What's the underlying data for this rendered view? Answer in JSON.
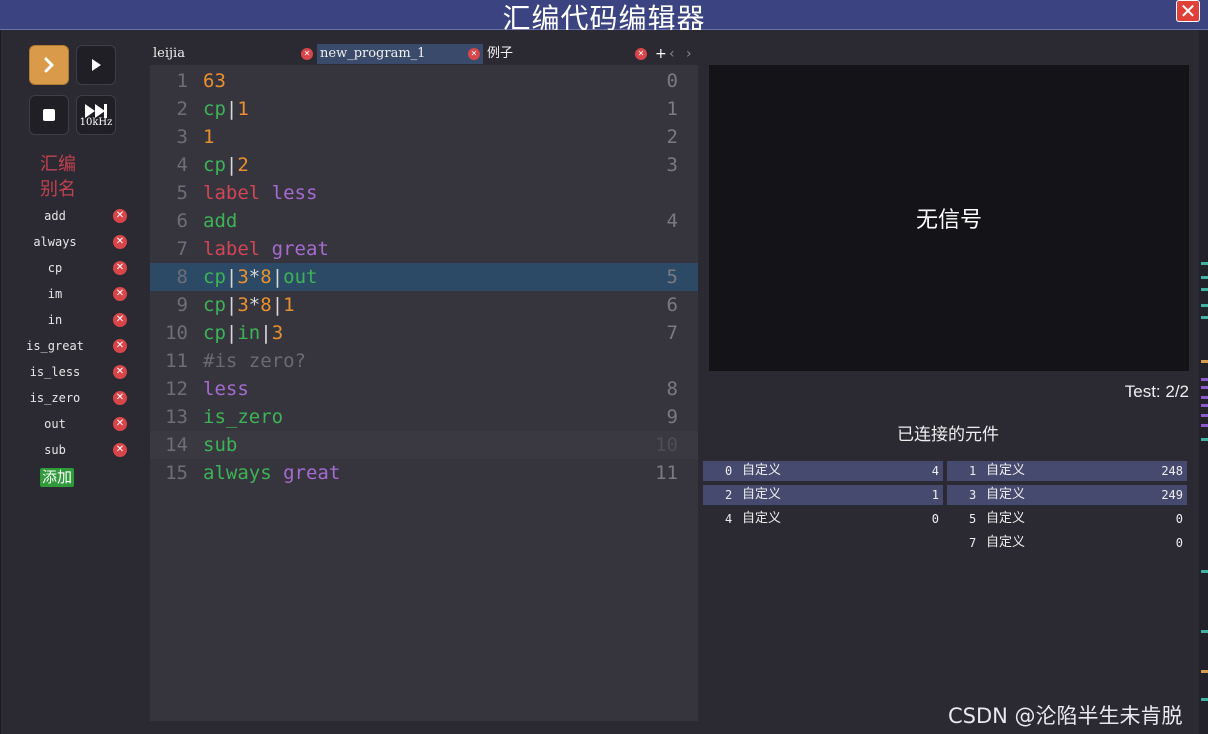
{
  "window": {
    "title": "汇编代码编辑器",
    "close_icon": "close-icon"
  },
  "controls": {
    "run_icon": "chevron-right-icon",
    "step_icon": "play-icon",
    "stop_icon": "stop-icon",
    "speed_icon": "fast-forward-icon",
    "speed_label": "10kHz",
    "accent": "#d99a4a"
  },
  "aliases": {
    "title": "汇编别名",
    "items": [
      "add",
      "always",
      "cp",
      "im",
      "in",
      "is_great",
      "is_less",
      "is_zero",
      "out",
      "sub"
    ],
    "add_label": "添加"
  },
  "tabs": {
    "items": [
      {
        "label": "leijia",
        "active": false
      },
      {
        "label": "new_program_1",
        "active": true
      },
      {
        "label": "例子",
        "active": false
      }
    ],
    "add_label": "+",
    "prev_label": "‹",
    "next_label": "›"
  },
  "editor": {
    "lines": [
      {
        "n": "1",
        "tokens": [
          [
            "63",
            "num"
          ]
        ],
        "addr": "0"
      },
      {
        "n": "2",
        "tokens": [
          [
            "cp",
            "green"
          ],
          [
            "|",
            "pipe"
          ],
          [
            "1",
            "num"
          ]
        ],
        "addr": "1"
      },
      {
        "n": "3",
        "tokens": [
          [
            "1",
            "num"
          ]
        ],
        "addr": "2"
      },
      {
        "n": "4",
        "tokens": [
          [
            "cp",
            "green"
          ],
          [
            "|",
            "pipe"
          ],
          [
            "2",
            "num"
          ]
        ],
        "addr": "3"
      },
      {
        "n": "5",
        "tokens": [
          [
            "label",
            "red"
          ],
          [
            " ",
            "pipe"
          ],
          [
            "less",
            "purple"
          ]
        ],
        "addr": ""
      },
      {
        "n": "6",
        "tokens": [
          [
            "add",
            "green"
          ]
        ],
        "addr": "4"
      },
      {
        "n": "7",
        "tokens": [
          [
            "label",
            "red"
          ],
          [
            " ",
            "pipe"
          ],
          [
            "great",
            "purple"
          ]
        ],
        "addr": ""
      },
      {
        "n": "8",
        "tokens": [
          [
            "cp",
            "green"
          ],
          [
            "|",
            "pipe"
          ],
          [
            "3",
            "num"
          ],
          [
            "*",
            "pipe"
          ],
          [
            "8",
            "num"
          ],
          [
            "|",
            "pipe"
          ],
          [
            "out",
            "green"
          ]
        ],
        "addr": "5",
        "state": "selected"
      },
      {
        "n": "9",
        "tokens": [
          [
            "cp",
            "green"
          ],
          [
            "|",
            "pipe"
          ],
          [
            "3",
            "num"
          ],
          [
            "*",
            "pipe"
          ],
          [
            "8",
            "num"
          ],
          [
            "|",
            "pipe"
          ],
          [
            "1",
            "num"
          ]
        ],
        "addr": "6"
      },
      {
        "n": "10",
        "tokens": [
          [
            "cp",
            "green"
          ],
          [
            "|",
            "pipe"
          ],
          [
            "in",
            "green"
          ],
          [
            "|",
            "pipe"
          ],
          [
            "3",
            "num"
          ]
        ],
        "addr": "7"
      },
      {
        "n": "11",
        "tokens": [
          [
            "#is zero?",
            "gray"
          ]
        ],
        "addr": ""
      },
      {
        "n": "12",
        "tokens": [
          [
            "less",
            "purple"
          ]
        ],
        "addr": "8"
      },
      {
        "n": "13",
        "tokens": [
          [
            "is_zero",
            "green"
          ]
        ],
        "addr": "9"
      },
      {
        "n": "14",
        "tokens": [
          [
            "sub",
            "green"
          ]
        ],
        "addr": "10",
        "state": "current"
      },
      {
        "n": "15",
        "tokens": [
          [
            "always",
            "green"
          ],
          [
            " ",
            "pipe"
          ],
          [
            "great",
            "purple"
          ]
        ],
        "addr": "11"
      }
    ],
    "colors": {
      "num": "#e8912e",
      "green": "#3db356",
      "red": "#d04655",
      "purple": "#a66bd0",
      "gray": "#6a6a72"
    }
  },
  "display": {
    "no_signal": "无信号",
    "test": "Test: 2/2"
  },
  "components": {
    "title": "已连接的元件",
    "items": [
      {
        "idx": "0",
        "name": "自定义",
        "value": "4",
        "col": 0,
        "row": 0,
        "shaded": true
      },
      {
        "idx": "1",
        "name": "自定义",
        "value": "248",
        "col": 1,
        "row": 0,
        "shaded": true
      },
      {
        "idx": "2",
        "name": "自定义",
        "value": "1",
        "col": 0,
        "row": 1,
        "shaded": true
      },
      {
        "idx": "3",
        "name": "自定义",
        "value": "249",
        "col": 1,
        "row": 1,
        "shaded": true
      },
      {
        "idx": "4",
        "name": "自定义",
        "value": "0",
        "col": 0,
        "row": 2,
        "shaded": false
      },
      {
        "idx": "5",
        "name": "自定义",
        "value": "0",
        "col": 1,
        "row": 2,
        "shaded": false
      },
      {
        "idx": "7",
        "name": "自定义",
        "value": "0",
        "col": 1,
        "row": 3,
        "shaded": false
      }
    ]
  },
  "watermark": "CSDN @沦陷半生未肯脱"
}
